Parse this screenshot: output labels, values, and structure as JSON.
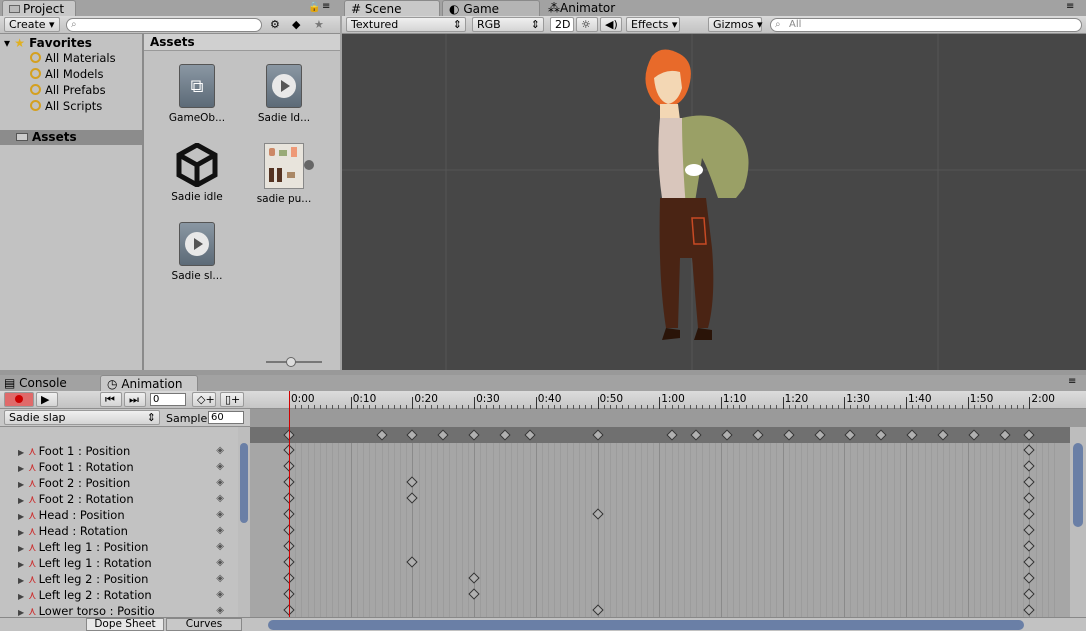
{
  "project": {
    "tab": "Project",
    "create_label": "Create",
    "favorites_label": "Favorites",
    "favorites": [
      "All Materials",
      "All Models",
      "All Prefabs",
      "All Scripts"
    ],
    "assets_label": "Assets",
    "assets_header": "Assets",
    "assets": [
      {
        "name": "GameOb...",
        "kind": "gameobject"
      },
      {
        "name": "Sadie Id...",
        "kind": "clip"
      },
      {
        "name": "Sadie idle",
        "kind": "unity"
      },
      {
        "name": "sadie pu...",
        "kind": "sprite"
      },
      {
        "name": "Sadie sl...",
        "kind": "clip"
      }
    ]
  },
  "scene": {
    "tabs": [
      "Scene",
      "Game",
      "Animator"
    ],
    "shading": "Textured",
    "channel": "RGB",
    "mode2d": "2D",
    "effects": "Effects",
    "gizmos": "Gizmos",
    "search_placeholder": "All"
  },
  "bottom_tabs": [
    "Console",
    "Animation"
  ],
  "animation": {
    "clip": "Sadie slap",
    "sample_label": "Sample",
    "sample_value": "60",
    "frame_value": "0",
    "time_labels": [
      "0:00",
      "0:10",
      "0:20",
      "0:30",
      "0:40",
      "0:50",
      "1:00",
      "1:10",
      "1:20",
      "1:30",
      "1:40",
      "1:50",
      "2:00"
    ],
    "properties": [
      {
        "label": "Foot 1 : Position",
        "keys": [
          0,
          120
        ]
      },
      {
        "label": "Foot 1 : Rotation",
        "keys": [
          0,
          120
        ]
      },
      {
        "label": "Foot 2 : Position",
        "keys": [
          0,
          20,
          120
        ]
      },
      {
        "label": "Foot 2 : Rotation",
        "keys": [
          0,
          20,
          120
        ]
      },
      {
        "label": "Head : Position",
        "keys": [
          0,
          50,
          120
        ]
      },
      {
        "label": "Head : Rotation",
        "keys": [
          0,
          120
        ]
      },
      {
        "label": "Left leg 1 : Position",
        "keys": [
          0,
          120
        ]
      },
      {
        "label": "Left leg 1 : Rotation",
        "keys": [
          0,
          20,
          120
        ]
      },
      {
        "label": "Left leg 2 : Position",
        "keys": [
          0,
          30,
          120
        ]
      },
      {
        "label": "Left leg 2 : Rotation",
        "keys": [
          0,
          30,
          120
        ]
      },
      {
        "label": "Lower torso : Positio",
        "keys": [
          0,
          50,
          120
        ]
      }
    ],
    "summary_keys": [
      0,
      15,
      20,
      25,
      30,
      35,
      39,
      50,
      62,
      66,
      71,
      76,
      81,
      86,
      91,
      96,
      101,
      106,
      111,
      116,
      120
    ],
    "view_tabs": [
      "Dope Sheet",
      "Curves"
    ]
  }
}
